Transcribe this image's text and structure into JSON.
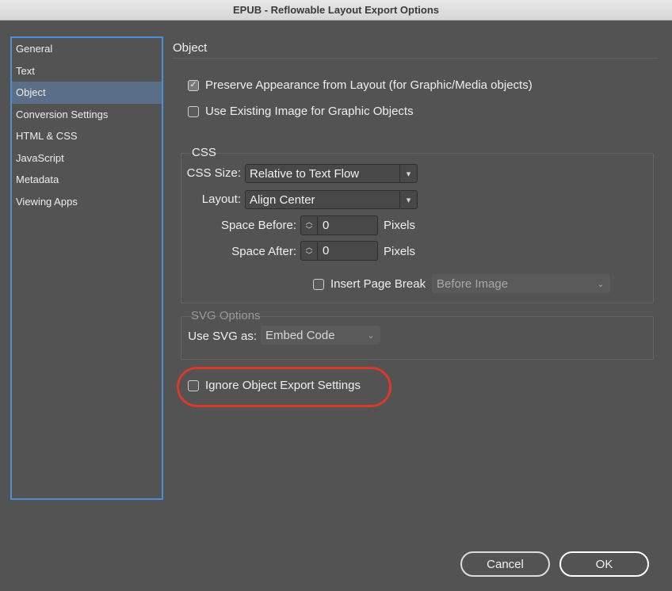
{
  "window": {
    "title": "EPUB - Reflowable Layout Export Options"
  },
  "sidebar": {
    "items": [
      {
        "label": "General"
      },
      {
        "label": "Text"
      },
      {
        "label": "Object",
        "selected": true
      },
      {
        "label": "Conversion Settings"
      },
      {
        "label": "HTML & CSS"
      },
      {
        "label": "JavaScript"
      },
      {
        "label": "Metadata"
      },
      {
        "label": "Viewing Apps"
      }
    ]
  },
  "object": {
    "title": "Object",
    "preserve_appearance": {
      "label": "Preserve Appearance from Layout (for Graphic/Media objects)",
      "checked": true
    },
    "use_existing_image": {
      "label": "Use Existing Image for Graphic Objects",
      "checked": false
    },
    "css": {
      "label": "CSS",
      "css_size_label": "CSS Size:",
      "css_size_value": "Relative to Text Flow",
      "layout_label": "Layout:",
      "layout_value": "Align Center",
      "space_before_label": "Space Before:",
      "space_before_value": "0",
      "space_after_label": "Space After:",
      "space_after_value": "0",
      "unit": "Pixels",
      "insert_page_break_label": "Insert Page Break",
      "insert_page_break_checked": false,
      "page_break_value": "Before Image"
    },
    "svg": {
      "label": "SVG Options",
      "use_svg_label": "Use SVG as:",
      "use_svg_value": "Embed Code"
    },
    "ignore_export": {
      "label": "Ignore Object Export Settings",
      "checked": false
    }
  },
  "buttons": {
    "cancel": "Cancel",
    "ok": "OK"
  },
  "colors": {
    "highlight": "#d93a2b",
    "selection": "#5a6e87",
    "focus": "#4b8fd4"
  }
}
